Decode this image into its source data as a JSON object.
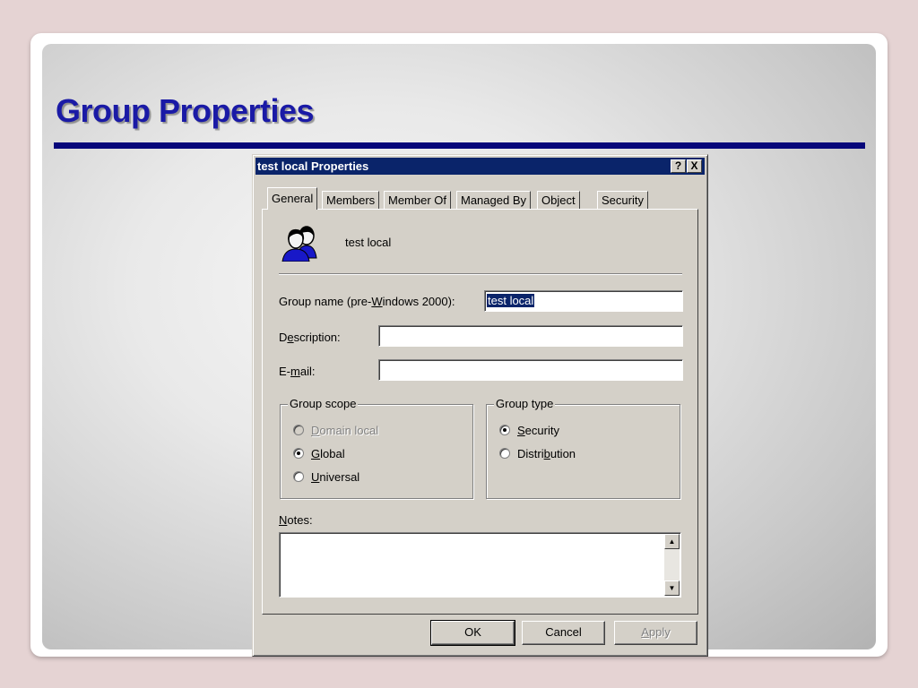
{
  "slide": {
    "title": "Group Properties"
  },
  "dialog": {
    "title": "test local Properties",
    "help_btn": "?",
    "close_btn": "X",
    "tabs": [
      {
        "label": "General",
        "active": true
      },
      {
        "label": "Members"
      },
      {
        "label": "Member Of"
      },
      {
        "label": "Managed By"
      },
      {
        "label": "Object"
      },
      {
        "label": "Security"
      }
    ],
    "heading": "test local",
    "group_name": {
      "label_before": "Group name (pre-",
      "label_key": "W",
      "label_after": "indows 2000):",
      "value": "test local"
    },
    "description": {
      "label_before": "D",
      "label_key": "e",
      "label_after": "scription:",
      "value": ""
    },
    "email": {
      "label_before": "E-",
      "label_key": "m",
      "label_after": "ail:",
      "value": ""
    },
    "group_scope": {
      "legend": "Group scope",
      "options": [
        {
          "key": "D",
          "rest": "omain local",
          "pre": "",
          "selected": false,
          "disabled": true
        },
        {
          "key": "G",
          "rest": "lobal",
          "pre": "",
          "selected": true,
          "disabled": false
        },
        {
          "key": "U",
          "rest": "niversal",
          "pre": "",
          "selected": false,
          "disabled": false
        }
      ]
    },
    "group_type": {
      "legend": "Group type",
      "options": [
        {
          "pre": "",
          "key": "S",
          "rest": "ecurity",
          "selected": true
        },
        {
          "pre": "Distri",
          "key": "b",
          "rest": "ution",
          "selected": false
        }
      ]
    },
    "notes": {
      "label_key": "N",
      "label_after": "otes:",
      "value": ""
    },
    "scroll_up": "▲",
    "scroll_down": "▼",
    "buttons": {
      "ok": "OK",
      "cancel": "Cancel",
      "apply_key": "A",
      "apply_rest": "pply"
    }
  }
}
